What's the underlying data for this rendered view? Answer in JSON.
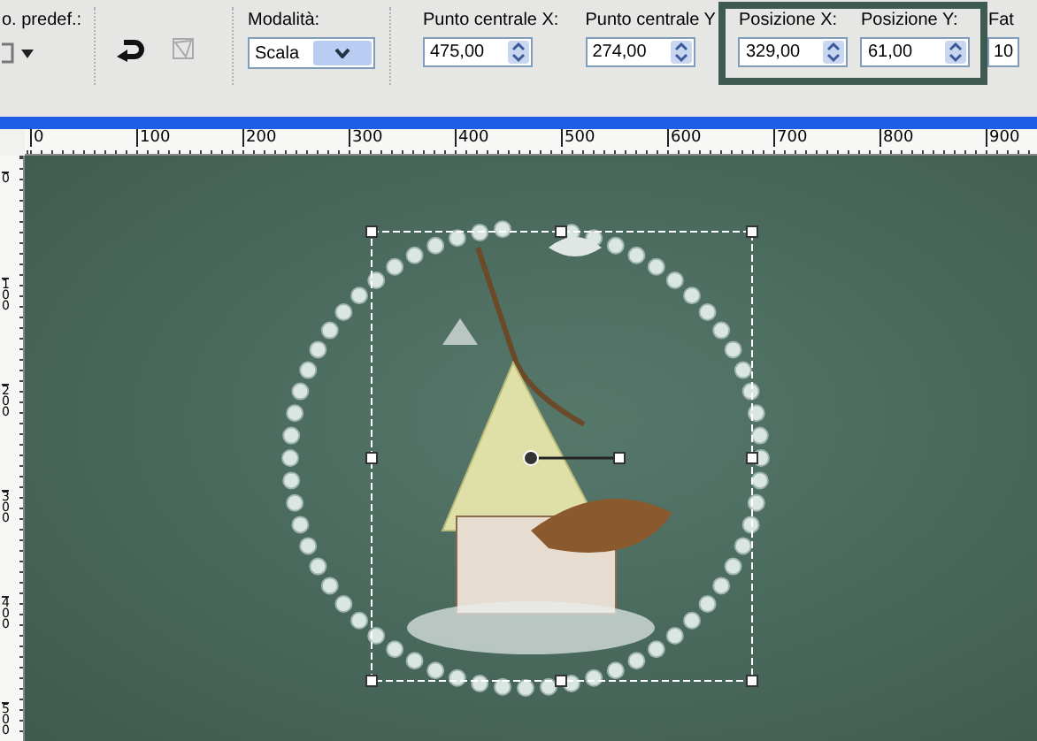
{
  "toolbar": {
    "preset_label": "o. predef.:",
    "mode": {
      "label": "Modalità:",
      "value": "Scala"
    },
    "fields": [
      {
        "label": "Punto centrale X:",
        "value": "475,00",
        "highlighted": false
      },
      {
        "label": "Punto centrale Y",
        "value": "274,00",
        "highlighted": false
      },
      {
        "label": "Posizione X:",
        "value": "329,00",
        "highlighted": true
      },
      {
        "label": "Posizione Y:",
        "value": "61,00",
        "highlighted": true
      },
      {
        "label": "Fat",
        "value": "10",
        "highlighted": false
      }
    ]
  },
  "rulers": {
    "horizontal": [
      "0",
      "100",
      "200",
      "300",
      "400",
      "500",
      "600",
      "700",
      "800",
      "900"
    ],
    "vertical": [
      "0",
      "100",
      "200",
      "300",
      "400",
      "500"
    ]
  }
}
